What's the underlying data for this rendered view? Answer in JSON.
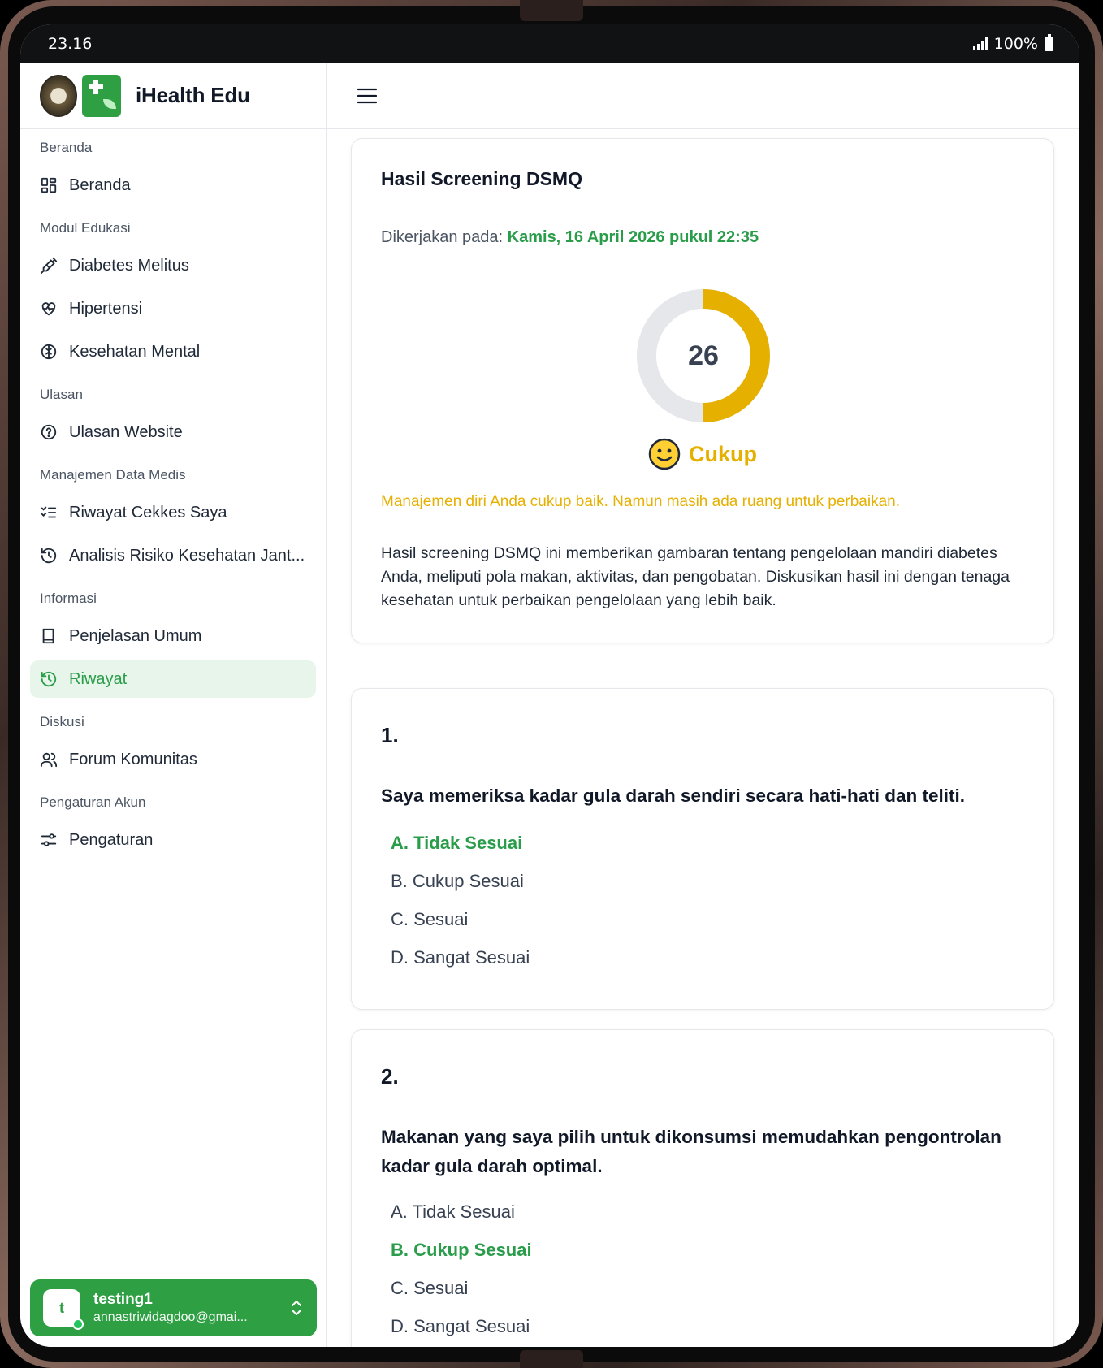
{
  "status": {
    "time": "23.16",
    "battery": "100%"
  },
  "brand": {
    "title": "iHealth Edu"
  },
  "nav": {
    "sections": [
      {
        "title": "Beranda",
        "items": [
          {
            "label": "Beranda",
            "icon": "dashboard-icon"
          }
        ]
      },
      {
        "title": "Modul Edukasi",
        "items": [
          {
            "label": "Diabetes Melitus",
            "icon": "syringe-icon"
          },
          {
            "label": "Hipertensi",
            "icon": "heart-pulse-icon"
          },
          {
            "label": "Kesehatan Mental",
            "icon": "brain-icon"
          }
        ]
      },
      {
        "title": "Ulasan",
        "items": [
          {
            "label": "Ulasan Website",
            "icon": "help-circle-icon"
          }
        ]
      },
      {
        "title": "Manajemen Data Medis",
        "items": [
          {
            "label": "Riwayat Cekkes Saya",
            "icon": "checklist-icon"
          },
          {
            "label": "Analisis Risiko Kesehatan Jant...",
            "icon": "history-icon"
          }
        ]
      },
      {
        "title": "Informasi",
        "items": [
          {
            "label": "Penjelasan Umum",
            "icon": "book-icon"
          },
          {
            "label": "Riwayat",
            "icon": "history-icon",
            "active": true
          }
        ]
      },
      {
        "title": "Diskusi",
        "items": [
          {
            "label": "Forum Komunitas",
            "icon": "users-icon"
          }
        ]
      },
      {
        "title": "Pengaturan Akun",
        "items": [
          {
            "label": "Pengaturan",
            "icon": "settings-sliders-icon"
          }
        ]
      }
    ]
  },
  "user": {
    "initial": "t",
    "name": "testing1",
    "email": "annastriwidagdoo@gmai..."
  },
  "result": {
    "title": "Hasil Screening DSMQ",
    "done_label": "Dikerjakan pada:",
    "done_date": "Kamis, 16 April 2026 pukul 22:35",
    "score": "26",
    "score_fraction": 0.5,
    "grade": "Cukup",
    "grade_color": "#e6b000",
    "message": "Manajemen diri Anda cukup baik. Namun masih ada ruang untuk perbaikan.",
    "description": "Hasil screening DSMQ ini memberikan gambaran tentang pengelolaan mandiri diabetes Anda, meliputi pola makan, aktivitas, dan pengobatan. Diskusikan hasil ini dengan tenaga kesehatan untuk perbaikan pengelolaan yang lebih baik."
  },
  "questions": [
    {
      "number": "1.",
      "text": "Saya memeriksa kadar gula darah sendiri secara hati-hati dan teliti.",
      "options": [
        "A. Tidak Sesuai",
        "B. Cukup Sesuai",
        "C. Sesuai",
        "D. Sangat Sesuai"
      ],
      "selected": 0
    },
    {
      "number": "2.",
      "text": "Makanan yang saya pilih untuk dikonsumsi memudahkan pengontrolan kadar gula darah optimal.",
      "options": [
        "A. Tidak Sesuai",
        "B. Cukup Sesuai",
        "C. Sesuai",
        "D. Sangat Sesuai"
      ],
      "selected": 1
    }
  ],
  "colors": {
    "accent": "#2ea043",
    "accent_text": "#2a9d4b",
    "warning": "#e6b000"
  }
}
